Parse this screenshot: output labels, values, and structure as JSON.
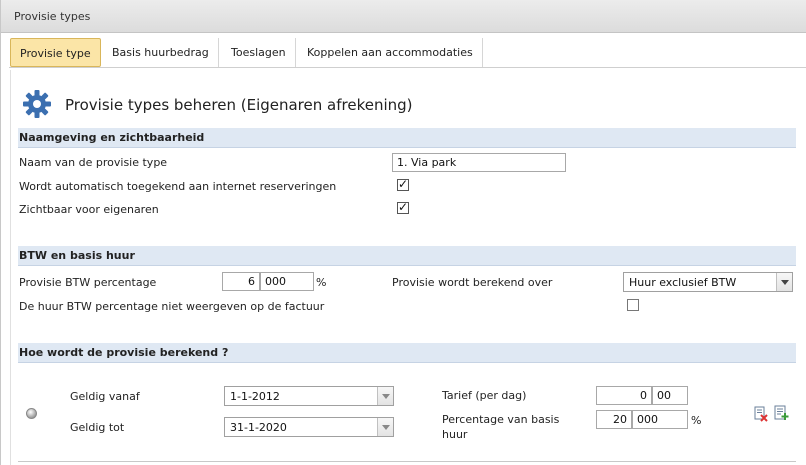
{
  "window": {
    "title": "Provisie types"
  },
  "tabs": [
    {
      "label": "Provisie type",
      "active": true
    },
    {
      "label": "Basis huurbedrag",
      "active": false
    },
    {
      "label": "Toeslagen",
      "active": false
    },
    {
      "label": "Koppelen aan accommodaties",
      "active": false
    }
  ],
  "page": {
    "title": "Provisie types beheren (Eigenaren afrekening)",
    "icon": "gear-icon"
  },
  "naming": {
    "header": "Naamgeving en zichtbaarheid",
    "name_label": "Naam van de provisie type",
    "name_value": "1. Via park",
    "auto_label": "Wordt automatisch toegekend aan internet reserveringen",
    "auto_checked": true,
    "visible_label": "Zichtbaar voor eigenaren",
    "visible_checked": true
  },
  "btw": {
    "header": "BTW en basis huur",
    "pct_label": "Provisie BTW percentage",
    "pct_int": "6",
    "pct_dec": "000",
    "pct_unit": "%",
    "over_label": "Provisie wordt berekend over",
    "over_value": "Huur exclusief BTW",
    "hide_label": "De huur BTW percentage niet weergeven op de factuur",
    "hide_checked": false
  },
  "calc": {
    "header": "Hoe wordt de provisie berekend ?",
    "from_label": "Geldig vanaf",
    "from_value": "1-1-2012",
    "to_label": "Geldig tot",
    "to_value": "31-1-2020",
    "tarief_label": "Tarief (per dag)",
    "tarief_int": "0",
    "tarief_dec": "00",
    "pct_label_1": "Percentage van basis",
    "pct_label_2": "huur",
    "pct_int": "20",
    "pct_dec": "000",
    "pct_unit": "%"
  },
  "colors": {
    "tab_active": "#fbe5a7",
    "section_bg": "#dfe8f3",
    "gear": "#3b6fb0"
  }
}
